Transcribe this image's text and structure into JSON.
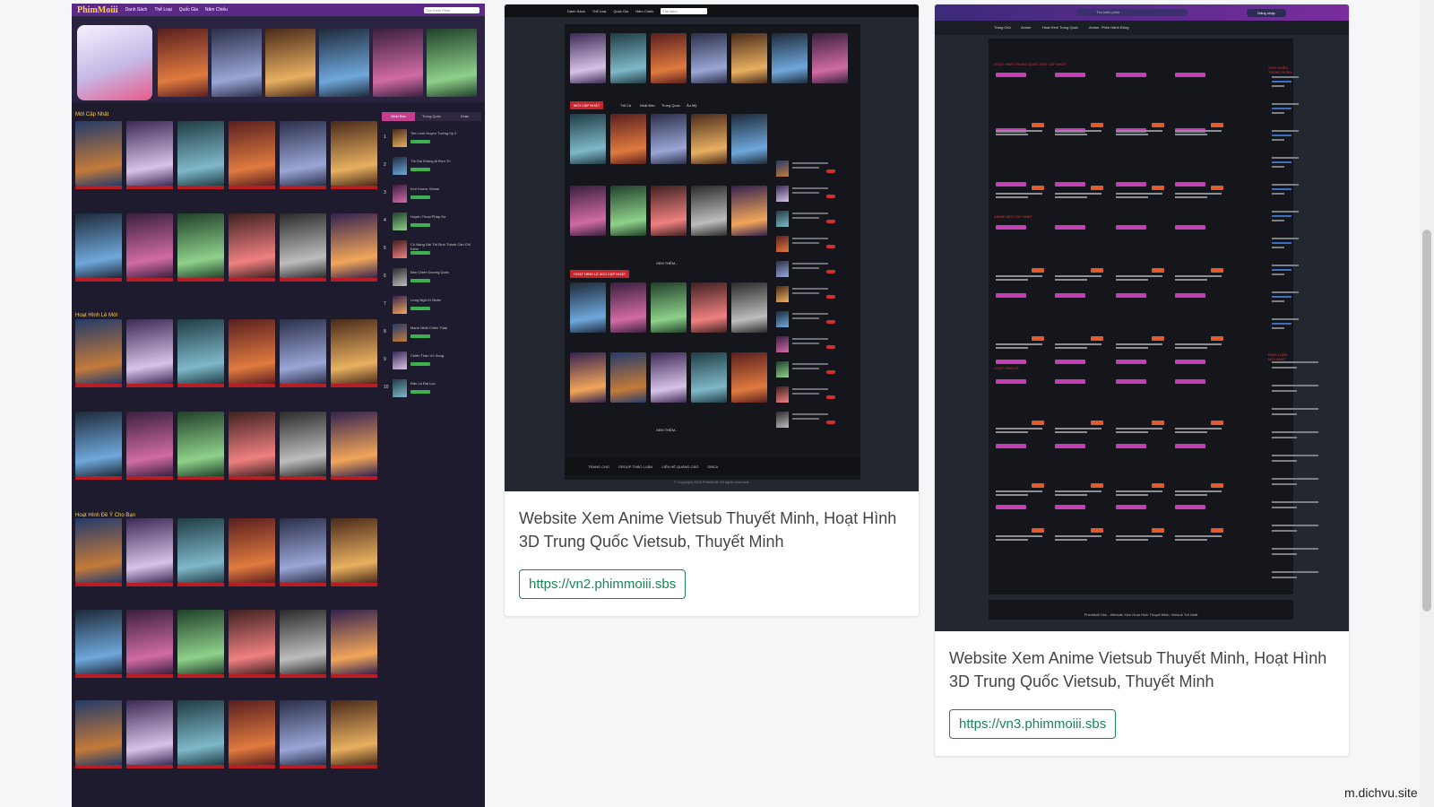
{
  "screenshot1": {
    "logo": "PhimMoiii",
    "nav_items": [
      "Danh Sách",
      "Thể Loại",
      "Quốc Gia",
      "Năm Chiếu"
    ],
    "search_placeholder": "Tìm Kiếm Phim",
    "sections": [
      "Mới Cập Nhật",
      "Hoạt Hình Lẻ Mới",
      "Hoạt Hình Đề Ý Cho Bạn"
    ],
    "tabs": [
      "Nhật Bản",
      "Trung Quốc",
      "Khác"
    ],
    "ranking": [
      {
        "num": "1",
        "title": "Tiên Linh Huyền Tướng Kỳ 2"
      },
      {
        "num": "2",
        "title": "Tôi Gọi Không Ai Đơn Trì"
      },
      {
        "num": "3",
        "title": "Kon Kuma: Sense"
      },
      {
        "num": "4",
        "title": "Huyền Thoại Pháp Sư"
      },
      {
        "num": "5",
        "title": "Cô Nàng Gái Tái Sinh Thành Cản Chỉ Kiếm"
      },
      {
        "num": "6",
        "title": "Bảo Chiến Dương Quốc"
      },
      {
        "num": "7",
        "title": "Lưng Ngữ Kí Nhân"
      },
      {
        "num": "8",
        "title": "Mạnh Nhất Chiến Thần"
      },
      {
        "num": "9",
        "title": "Chiến Thần Vô Song"
      },
      {
        "num": "10",
        "title": "Đấu La Đại Lục"
      }
    ]
  },
  "card2": {
    "nav_items": [
      "Danh Sách",
      "Thể Loại",
      "Quốc Gia",
      "Năm Chiếu"
    ],
    "search_placeholder": "Tìm kiếm",
    "badge_new": "MỚI CẬP NHẬT",
    "tabs": [
      "Tất Cả",
      "Nhật Bản",
      "Trung Quốc",
      "Âu Mỹ"
    ],
    "badge_movies": "HOẠT HÌNH LẺ MỚI CẬP NHẬT",
    "more_label": "XEM THÊM...",
    "footer_items": [
      "TRANG CHỦ",
      "GROUP THẢO LUẬN",
      "LIÊN HỆ QUẢNG CÁO",
      "DMCA"
    ],
    "copyright": "© Copyright 2023 PhimMoiii. All rights reserved.",
    "title": "Website Xem Anime Vietsub Thuyết Minh, Hoạt Hình 3D Trung Quốc Vietsub, Thuyết Minh",
    "url": "https://vn2.phimmoiii.sbs"
  },
  "card3": {
    "search_placeholder": "Tìm kiếm phim...",
    "login_label": "Đăng nhập",
    "sub_nav": [
      "Trang Chủ",
      "Anime",
      "Hoạt Hình Trung Quốc",
      "Anime",
      "Phim Hành Động"
    ],
    "section_titles": [
      "HOẠT HÌNH TRUNG QUỐC MỚI CẬP NHẬT",
      "ANIME MỚI CẬP NHẬT",
      "HOẠT HÌNH LẺ"
    ],
    "side_titles": [
      "XEM NHIỀU TRONG NGÀY",
      "BÌNH LUẬN MỚI NHẤT"
    ],
    "footer": "PhimMoiii.Sbs - Website Xem Hoạt Hình Thuyết Minh, Vietsub Tốt Nhất",
    "title": "Website Xem Anime Vietsub Thuyết Minh, Hoạt Hình 3D Trung Quốc Vietsub, Thuyết Minh",
    "url": "https://vn3.phimmoiii.sbs"
  },
  "watermark": "m.dichvu.site",
  "colors": {
    "accent_green": "#198754",
    "purple_nav": "#5b2a86",
    "pink_tab": "#c43f8f",
    "red_badge": "#c8242b"
  }
}
